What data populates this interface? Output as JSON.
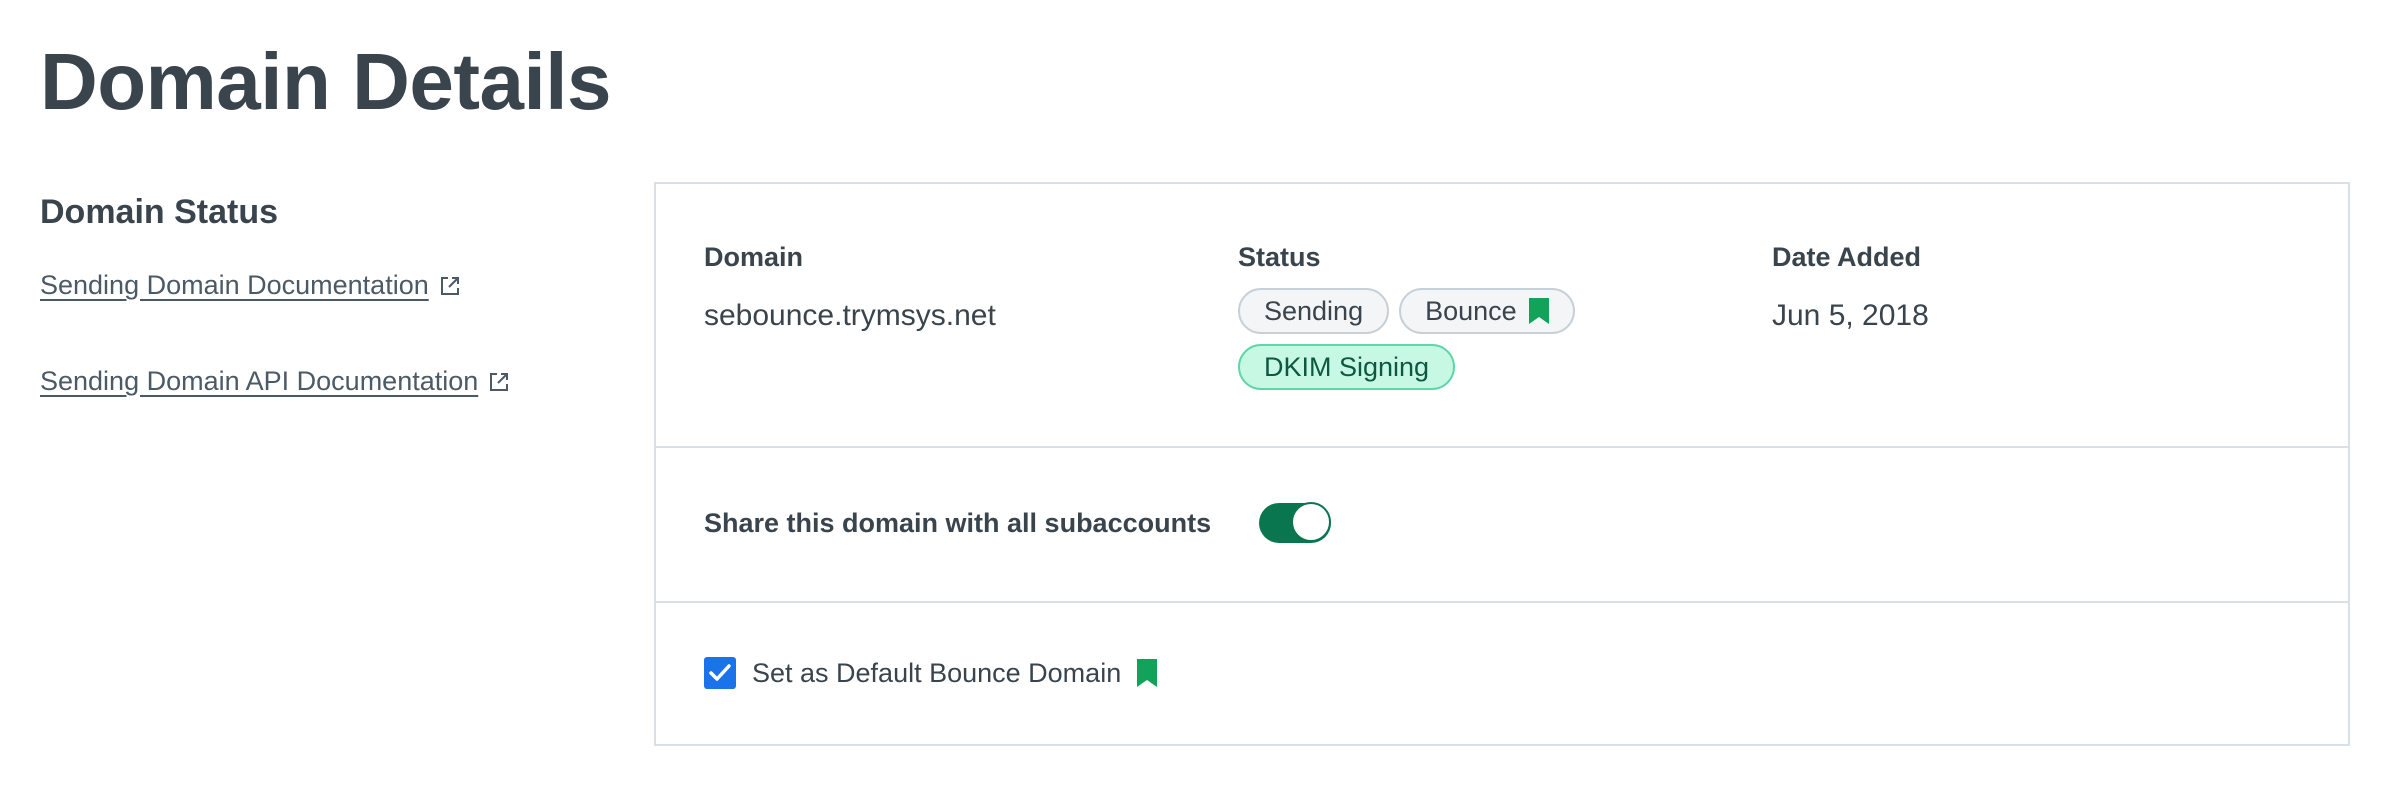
{
  "page": {
    "title": "Domain Details"
  },
  "sidebar": {
    "heading": "Domain Status",
    "links": [
      {
        "label": "Sending Domain Documentation",
        "icon": "external-link-icon"
      },
      {
        "label": "Sending Domain API Documentation",
        "icon": "external-link-icon"
      }
    ]
  },
  "details": {
    "columns": {
      "domain_label": "Domain",
      "status_label": "Status",
      "date_label": "Date Added"
    },
    "domain": "sebounce.trymsys.net",
    "statuses": [
      {
        "label": "Sending",
        "style": "neutral"
      },
      {
        "label": "Bounce",
        "style": "neutral",
        "icon": "bookmark-icon"
      },
      {
        "label": "DKIM Signing",
        "style": "success"
      }
    ],
    "date_added": "Jun 5, 2018"
  },
  "share": {
    "label": "Share this domain with all subaccounts",
    "enabled": true
  },
  "default_bounce": {
    "label": "Set as Default Bounce Domain",
    "checked": true,
    "icon": "bookmark-icon"
  },
  "colors": {
    "accent_green": "#0a7650",
    "bookmark_green": "#11a35a",
    "checkbox_blue": "#1a73e8",
    "success_tag_bg": "#c7f8e4",
    "text": "#39444d",
    "border": "#d9e0e6"
  }
}
